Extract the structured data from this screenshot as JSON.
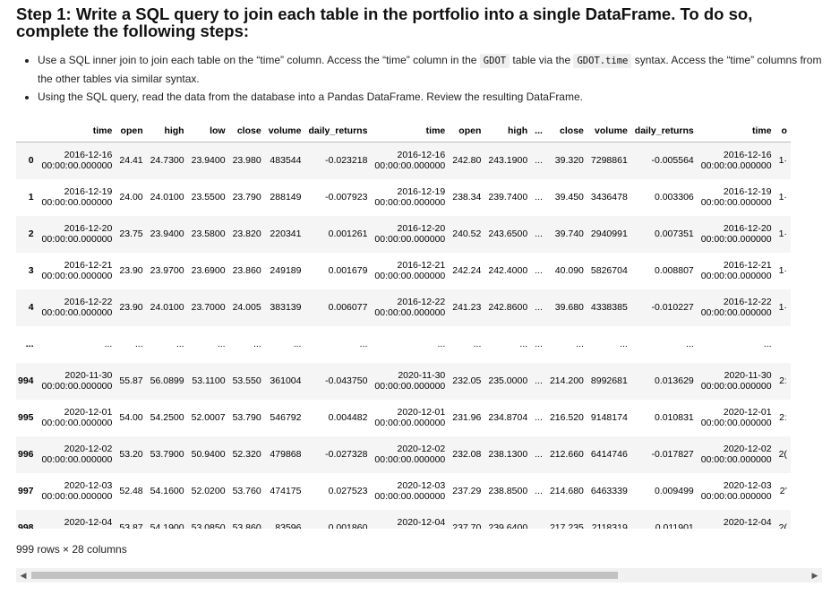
{
  "heading": "Step 1: Write a SQL query to join each table in the portfolio into a single DataFrame. To do so, complete the following steps:",
  "bullets": {
    "b1_part1": "Use a SQL inner join to join each table on the “time” column. Access the “time” column in the ",
    "b1_code1": "GDOT",
    "b1_part2": " table via the ",
    "b1_code2": "GDOT.time",
    "b1_part3": " syntax. Access the “time” columns from the other tables via similar syntax.",
    "b2": "Using the SQL query, read the data from the database into a Pandas DataFrame. Review the resulting DataFrame."
  },
  "table": {
    "columns": [
      "",
      "time",
      "open",
      "high",
      "low",
      "close",
      "volume",
      "daily_returns",
      "time",
      "open",
      "high",
      "...",
      "close",
      "volume",
      "daily_returns",
      "time",
      "o"
    ],
    "rows": [
      [
        "0",
        "2016-12-16\n00:00:00.000000",
        "24.41",
        "24.7300",
        "23.9400",
        "23.980",
        "483544",
        "-0.023218",
        "2016-12-16\n00:00:00.000000",
        "242.80",
        "243.1900",
        "...",
        "39.320",
        "7298861",
        "-0.005564",
        "2016-12-16\n00:00:00.000000",
        "1·"
      ],
      [
        "1",
        "2016-12-19\n00:00:00.000000",
        "24.00",
        "24.0100",
        "23.5500",
        "23.790",
        "288149",
        "-0.007923",
        "2016-12-19\n00:00:00.000000",
        "238.34",
        "239.7400",
        "...",
        "39.450",
        "3436478",
        "0.003306",
        "2016-12-19\n00:00:00.000000",
        "1·"
      ],
      [
        "2",
        "2016-12-20\n00:00:00.000000",
        "23.75",
        "23.9400",
        "23.5800",
        "23.820",
        "220341",
        "0.001261",
        "2016-12-20\n00:00:00.000000",
        "240.52",
        "243.6500",
        "...",
        "39.740",
        "2940991",
        "0.007351",
        "2016-12-20\n00:00:00.000000",
        "1·"
      ],
      [
        "3",
        "2016-12-21\n00:00:00.000000",
        "23.90",
        "23.9700",
        "23.6900",
        "23.860",
        "249189",
        "0.001679",
        "2016-12-21\n00:00:00.000000",
        "242.24",
        "242.4000",
        "...",
        "40.090",
        "5826704",
        "0.008807",
        "2016-12-21\n00:00:00.000000",
        "1·"
      ],
      [
        "4",
        "2016-12-22\n00:00:00.000000",
        "23.90",
        "24.0100",
        "23.7000",
        "24.005",
        "383139",
        "0.006077",
        "2016-12-22\n00:00:00.000000",
        "241.23",
        "242.8600",
        "...",
        "39.680",
        "4338385",
        "-0.010227",
        "2016-12-22\n00:00:00.000000",
        "1·"
      ],
      [
        "...",
        "...",
        "...",
        "...",
        "...",
        "...",
        "...",
        "...",
        "...",
        "...",
        "...",
        "...",
        "...",
        "...",
        "...",
        "...",
        ""
      ],
      [
        "994",
        "2020-11-30\n00:00:00.000000",
        "55.87",
        "56.0899",
        "53.1100",
        "53.550",
        "361004",
        "-0.043750",
        "2020-11-30\n00:00:00.000000",
        "232.05",
        "235.0000",
        "...",
        "214.200",
        "8992681",
        "0.013629",
        "2020-11-30\n00:00:00.000000",
        "2ː"
      ],
      [
        "995",
        "2020-12-01\n00:00:00.000000",
        "54.00",
        "54.2500",
        "52.0007",
        "53.790",
        "546792",
        "0.004482",
        "2020-12-01\n00:00:00.000000",
        "231.96",
        "234.8704",
        "...",
        "216.520",
        "9148174",
        "0.010831",
        "2020-12-01\n00:00:00.000000",
        "2ː"
      ],
      [
        "996",
        "2020-12-02\n00:00:00.000000",
        "53.20",
        "53.7900",
        "50.9400",
        "52.320",
        "479868",
        "-0.027328",
        "2020-12-02\n00:00:00.000000",
        "232.08",
        "238.1300",
        "...",
        "212.660",
        "6414746",
        "-0.017827",
        "2020-12-02\n00:00:00.000000",
        "2("
      ],
      [
        "997",
        "2020-12-03\n00:00:00.000000",
        "52.48",
        "54.1600",
        "52.0200",
        "53.760",
        "474175",
        "0.027523",
        "2020-12-03\n00:00:00.000000",
        "237.29",
        "238.8500",
        "...",
        "214.680",
        "6463339",
        "0.009499",
        "2020-12-03\n00:00:00.000000",
        "2’"
      ],
      [
        "998",
        "2020-12-04\n00:00:00.000000",
        "53.87",
        "54.1900",
        "53.0850",
        "53.860",
        "83596",
        "0.001860",
        "2020-12-04\n00:00:00.000000",
        "237.70",
        "239.6400",
        "...",
        "217.235",
        "2118319",
        "0.011901",
        "2020-12-04\n00:00:00.000000",
        "2("
      ]
    ]
  },
  "footer": "999 rows × 28 columns",
  "scrollbar": {
    "left_arrow_icon": "triangle-left-icon",
    "right_arrow_icon": "triangle-right-icon"
  }
}
